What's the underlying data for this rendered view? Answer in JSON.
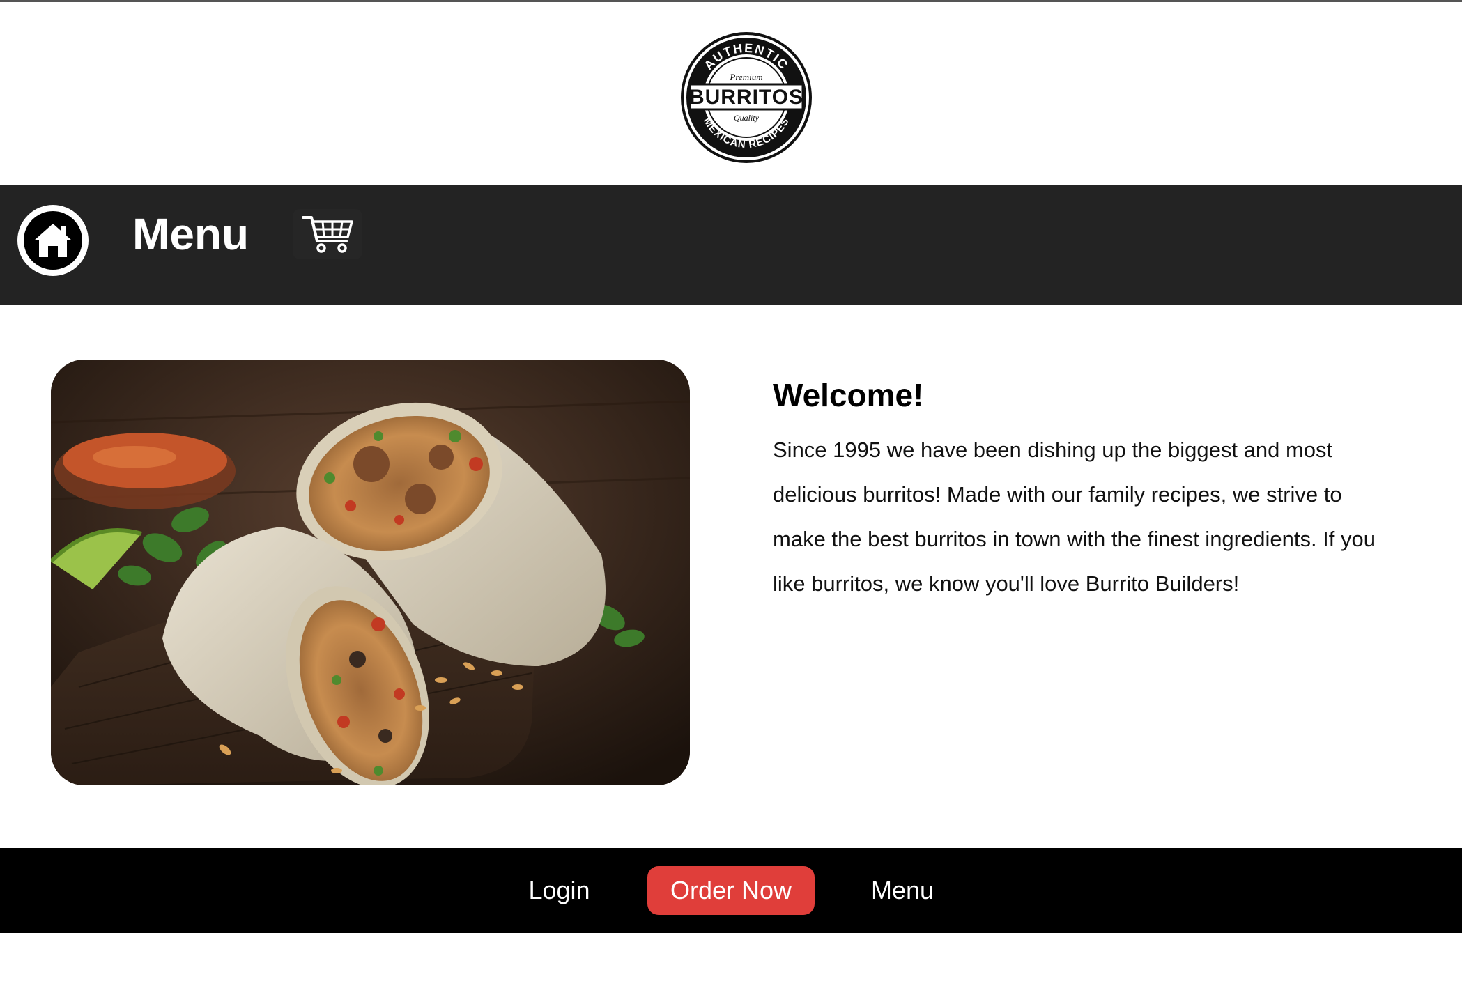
{
  "header": {
    "logo": {
      "arc_top": "AUTHENTIC",
      "premium": "Premium",
      "brand": "BURRITOS",
      "quality": "Quality",
      "arc_bottom": "MEXICAN RECIPES"
    }
  },
  "nav": {
    "home_icon": "home-icon",
    "menu_label": "Menu",
    "cart_icon": "shopping-cart-icon"
  },
  "main": {
    "image_alt": "Two burrito halves on a wooden board with salsa, lime and cilantro",
    "title": "Welcome!",
    "body": "Since 1995 we have been dishing up the biggest and most delicious burritos! Made with our family recipes, we strive to make the best burritos in town with the finest ingredients. If you like burritos, we know you'll love Burrito Builders!"
  },
  "footer": {
    "login_label": "Login",
    "order_label": "Order Now",
    "menu_label": "Menu"
  },
  "colors": {
    "navbar": "#232323",
    "footer": "#000000",
    "order_button": "#e03e3a",
    "text": "#111111"
  }
}
